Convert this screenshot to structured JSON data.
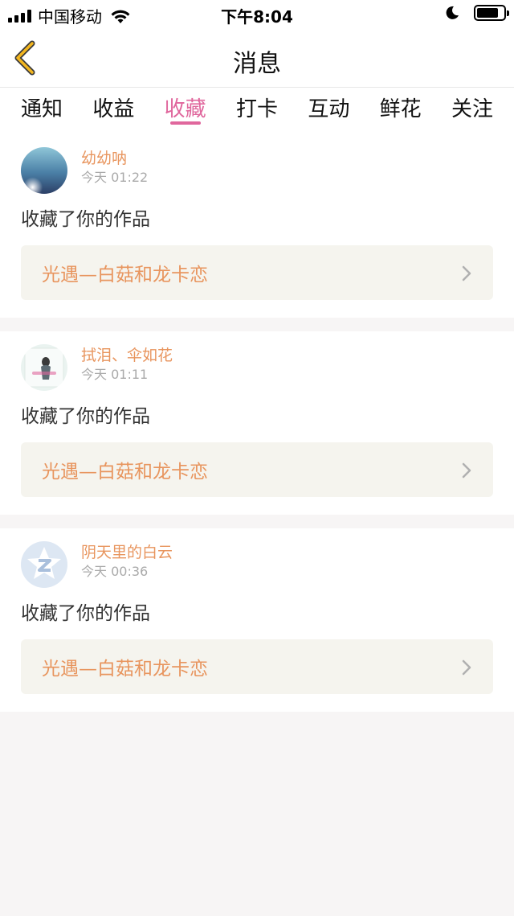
{
  "status_bar": {
    "carrier": "中国移动",
    "time": "下午8:04"
  },
  "nav": {
    "title": "消息",
    "back_icon": "chevron-left-icon",
    "accent": "#f3b61f"
  },
  "tabs": [
    {
      "label": "通知",
      "active": false
    },
    {
      "label": "收益",
      "active": false
    },
    {
      "label": "收藏",
      "active": true
    },
    {
      "label": "打卡",
      "active": false
    },
    {
      "label": "互动",
      "active": false
    },
    {
      "label": "鲜花",
      "active": false
    },
    {
      "label": "关注",
      "active": false
    }
  ],
  "colors": {
    "tab_active": "#e0679d",
    "username": "#e8955e",
    "link_bg": "#f5f4ee"
  },
  "messages": [
    {
      "username": "幼幼呐",
      "time": "今天 01:22",
      "action": "收藏了你的作品",
      "work": "光遇—白菇和龙卡恋"
    },
    {
      "username": "拭泪、伞如花",
      "time": "今天 01:11",
      "action": "收藏了你的作品",
      "work": "光遇—白菇和龙卡恋"
    },
    {
      "username": "阴天里的白云",
      "time": "今天 00:36",
      "action": "收藏了你的作品",
      "work": "光遇—白菇和龙卡恋"
    }
  ]
}
